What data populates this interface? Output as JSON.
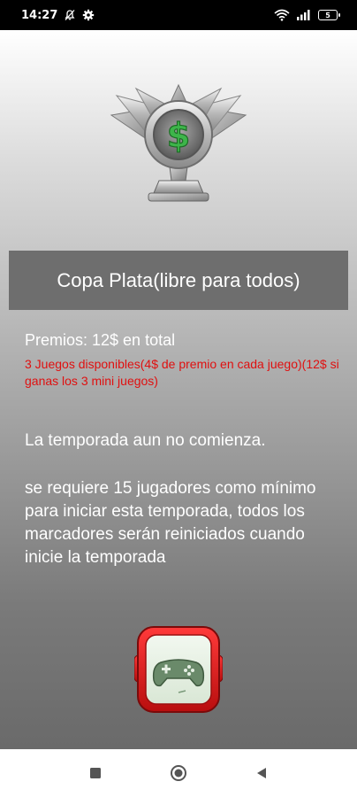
{
  "status_bar": {
    "time": "14:27",
    "battery": "5",
    "icons": [
      "notifications-off-icon",
      "settings-gear-icon",
      "wifi-icon",
      "signal-icon",
      "battery-icon"
    ]
  },
  "trophy": {
    "icon": "silver-dollar-trophy-icon",
    "symbol": "$"
  },
  "cup": {
    "title": "Copa Plata(libre para todos)"
  },
  "prizes": {
    "total": "Premios: 12$ en total",
    "detail": "3 Juegos disponibles(4$ de premio en cada juego)(12$ si ganas los 3 mini juegos)",
    "detail_color": "#e01010"
  },
  "season": {
    "status": "La temporada aun no comienza.",
    "requirement": "se requiere 15 jugadores como mínimo para iniciar esta temporada, todos los marcadores serán reiniciados cuando inicie la temporada"
  },
  "play_button": {
    "icon": "gamepad-icon",
    "accent": "#e01818"
  },
  "nav": {
    "items": [
      "recent-apps-icon",
      "home-icon",
      "back-icon"
    ]
  }
}
